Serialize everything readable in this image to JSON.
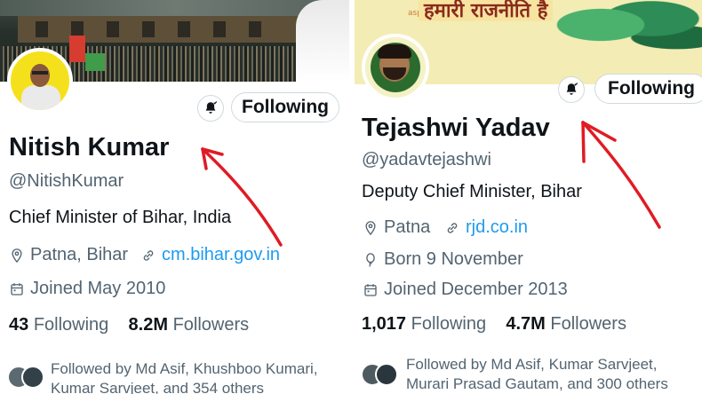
{
  "left_profile": {
    "name": "Nitish Kumar",
    "handle": "@NitishKumar",
    "bio": "Chief Minister of Bihar, India",
    "location": "Patna, Bihar",
    "website": "cm.bihar.gov.in",
    "joined": "Joined May 2010",
    "following_count": "43",
    "following_label": "Following",
    "followers_count": "8.2M",
    "followers_label": "Followers",
    "followed_by_line1": "Followed by Md Asif, Khushboo Kumari,",
    "followed_by_line2": "Kumar Sarvjeet, and 354 others",
    "follow_button": "Following"
  },
  "right_profile": {
    "name": "Tejashwi Yadav",
    "handle": "@yadavtejashwi",
    "bio": "Deputy Chief Minister, Bihar",
    "location": "Patna",
    "website": "rjd.co.in",
    "born": "Born 9 November",
    "joined": "Joined December 2013",
    "following_count": "1,017",
    "following_label": "Following",
    "followers_count": "4.7M",
    "followers_label": "Followers",
    "followed_by_line1": "Followed by Md Asif, Kumar Sarvjeet,",
    "followed_by_line2": "Murari Prasad Gautam, and 300 others",
    "follow_button": "Following",
    "banner_text": "हमारी राजनीति है",
    "banner_small_text": "aspirations"
  },
  "icons": {
    "bell": "bell-icon",
    "location": "location-pin-icon",
    "link": "link-icon",
    "calendar": "calendar-icon",
    "balloon": "birthday-balloon-icon"
  },
  "colors": {
    "link": "#1d9bf0",
    "secondary_text": "#536471",
    "arrow": "#e01b24",
    "border": "#cfd9de"
  }
}
